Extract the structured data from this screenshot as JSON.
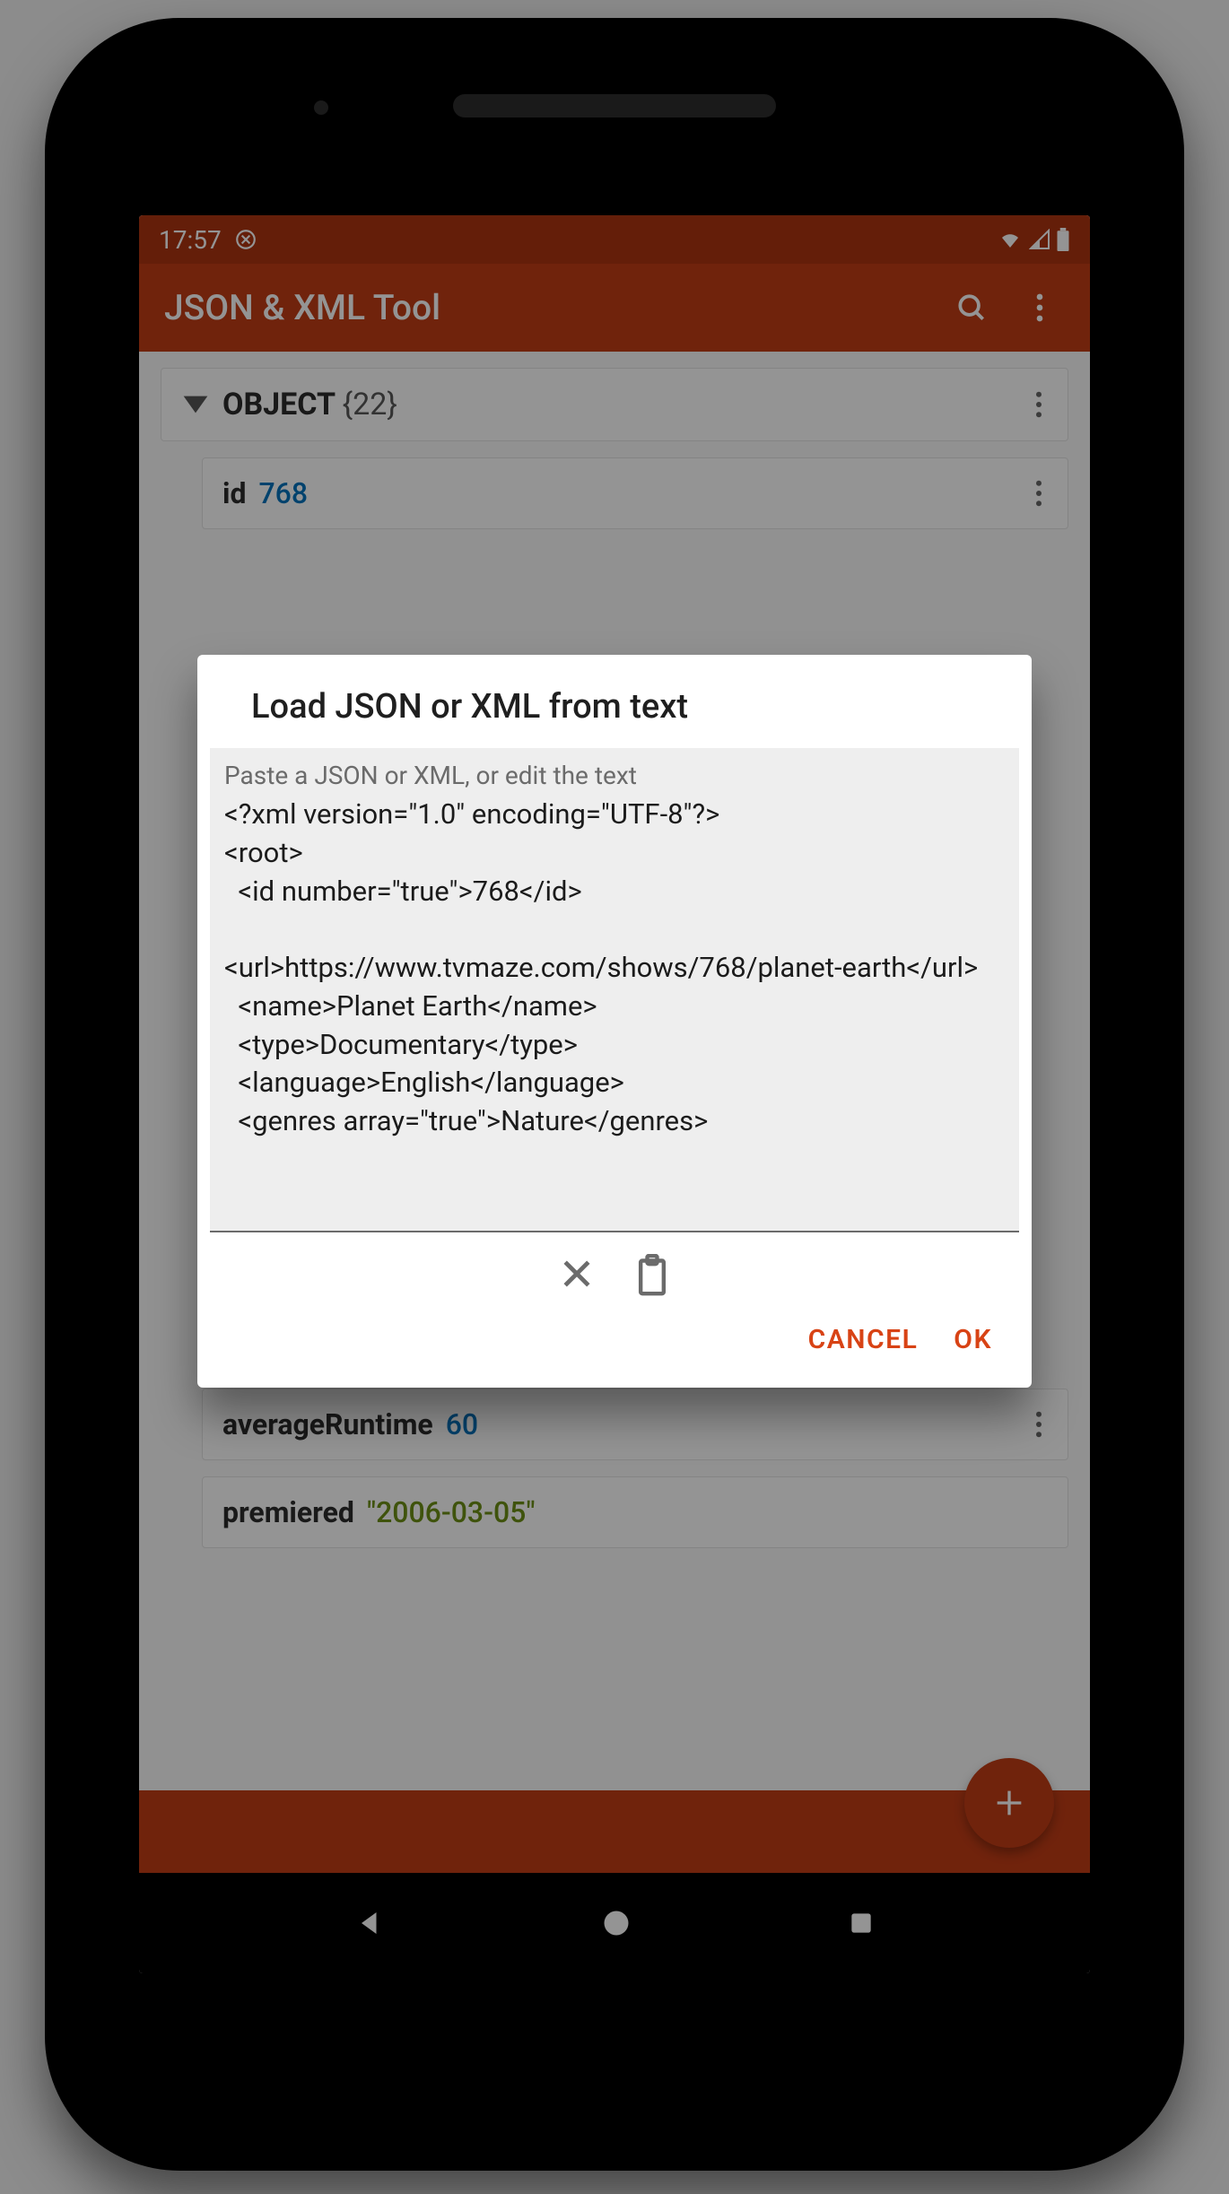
{
  "statusbar": {
    "time": "17:57"
  },
  "appbar": {
    "title": "JSON & XML Tool"
  },
  "object_header": {
    "label": "OBJECT",
    "count": "{22}"
  },
  "fields": [
    {
      "key": "id",
      "val": "768",
      "type": "num"
    },
    {
      "key": "averageRuntime",
      "val": "60",
      "type": "num"
    },
    {
      "key": "premiered",
      "val": "\"2006-03-05\"",
      "type": "str"
    }
  ],
  "dialog": {
    "title": "Load JSON or XML from text",
    "placeholder": "Paste a JSON or XML, or edit the text",
    "content": "<?xml version=\"1.0\" encoding=\"UTF-8\"?>\n<root>\n  <id number=\"true\">768</id>\n\n<url>https://www.tvmaze.com/shows/768/planet-earth</url>\n  <name>Planet Earth</name>\n  <type>Documentary</type>\n  <language>English</language>\n  <genres array=\"true\">Nature</genres>",
    "cancel": "CANCEL",
    "ok": "OK"
  }
}
